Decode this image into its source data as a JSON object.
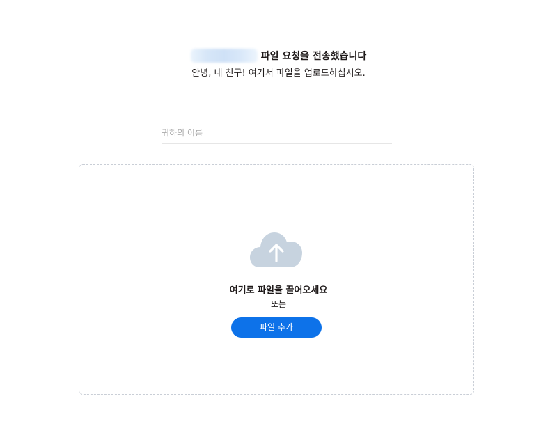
{
  "header": {
    "title_suffix": "파일 요청을 전송했습니다",
    "subtitle": "안녕, 내 친구! 여기서 파일을 업로드하십시오."
  },
  "form": {
    "name_placeholder": "귀하의 이름",
    "name_value": ""
  },
  "drop_zone": {
    "icon": "cloud-upload-icon",
    "title": "여기로 파일을 끌어오세요",
    "or_text": "또는",
    "add_button_label": "파일 추가"
  },
  "colors": {
    "accent": "#0d72e9",
    "cloud": "#c7d3df",
    "dashed_border": "#c9ced6"
  }
}
